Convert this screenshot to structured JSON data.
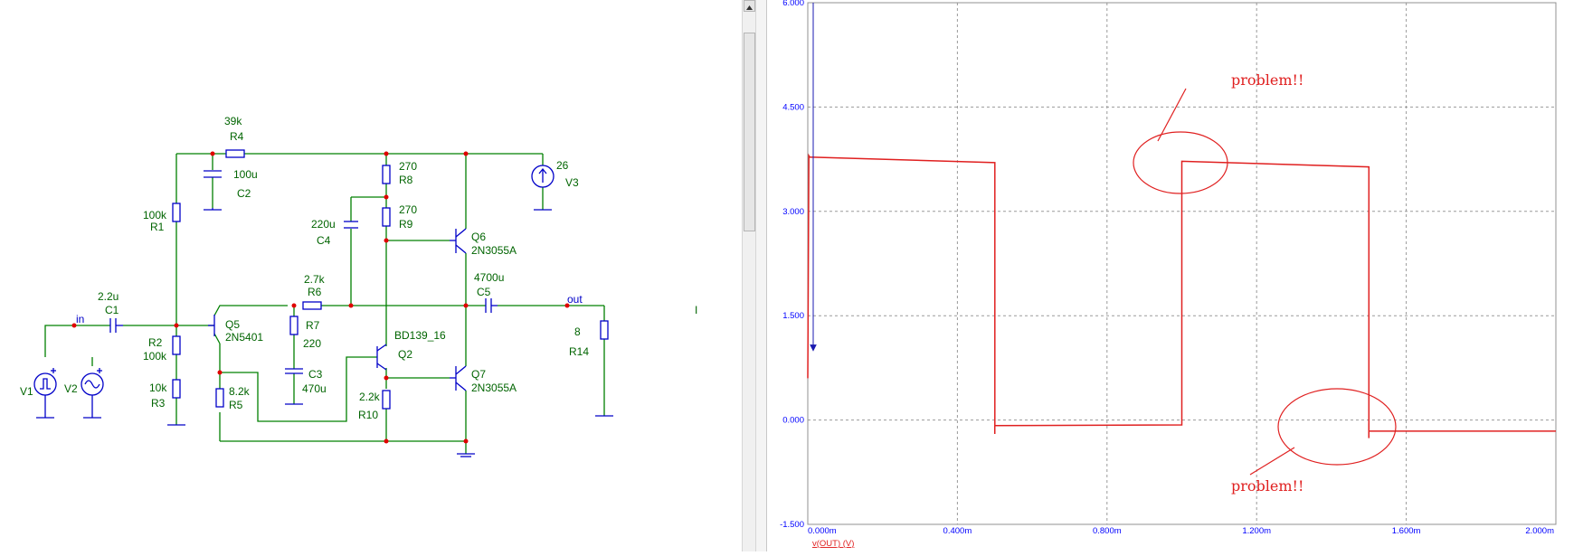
{
  "schematic": {
    "components": {
      "r4": {
        "name": "R4",
        "value": "39k"
      },
      "c2": {
        "name": "C2",
        "value": "100u"
      },
      "r1": {
        "name": "R1",
        "value": "100k"
      },
      "r8": {
        "name": "R8",
        "value": "270"
      },
      "r9": {
        "name": "R9",
        "value": "270"
      },
      "c4": {
        "name": "C4",
        "value": "220u"
      },
      "q6": {
        "name": "Q6",
        "value": "2N3055A"
      },
      "v3": {
        "name": "V3",
        "value": "26"
      },
      "c1": {
        "name": "C1",
        "value": "2.2u"
      },
      "r6": {
        "name": "R6",
        "value": "2.7k"
      },
      "c5": {
        "name": "C5",
        "value": "4700u"
      },
      "q5": {
        "name": "Q5",
        "value": "2N5401"
      },
      "r7": {
        "name": "R7",
        "value": "220"
      },
      "r2": {
        "name": "R2",
        "value": "100k"
      },
      "r3": {
        "name": "R3",
        "value": "10k"
      },
      "q2": {
        "name": "Q2",
        "value": "BD139_16"
      },
      "r14": {
        "name": "R14",
        "value": "8"
      },
      "c3": {
        "name": "C3",
        "value": "470u"
      },
      "r5": {
        "name": "R5",
        "value": "8.2k"
      },
      "r10": {
        "name": "R10",
        "value": "2.2k"
      },
      "q7": {
        "name": "Q7",
        "value": "2N3055A"
      },
      "v1": {
        "name": "V1"
      },
      "v2": {
        "name": "V2"
      }
    },
    "nets": {
      "in": "in",
      "out": "out"
    },
    "cursor_mark": "I"
  },
  "colors": {
    "wire": "#008000",
    "component": "#0000c8",
    "junction": "#e00000",
    "label": "#006400",
    "trace": "#e02020",
    "grid": "#9a9a9a",
    "axis_text": "#0000ff"
  },
  "plot": {
    "trace_label": "v(OUT) (V)",
    "x_ticks": [
      "0.000m",
      "0.400m",
      "0.800m",
      "1.200m",
      "1.600m",
      "2.000m"
    ],
    "y_ticks": [
      "6.000",
      "4.500",
      "3.000",
      "1.500",
      "0.000",
      "-1.500"
    ],
    "annotations": [
      "problem!!",
      "problem!!"
    ]
  },
  "chart_data": {
    "type": "line",
    "xlabel": "",
    "ylabel": "",
    "xlim": [
      0,
      2.0
    ],
    "ylim": [
      -1.5,
      6.0
    ],
    "grid": true,
    "series": [
      {
        "name": "v(OUT) (V)",
        "x": [
          0.0,
          0.003,
          0.005,
          0.5,
          0.5,
          1.0,
          1.0,
          1.5,
          1.5,
          2.0
        ],
        "y": [
          0.6,
          3.8,
          3.78,
          3.7,
          -0.08,
          -0.07,
          3.72,
          3.64,
          -0.16,
          -0.16
        ]
      }
    ]
  }
}
